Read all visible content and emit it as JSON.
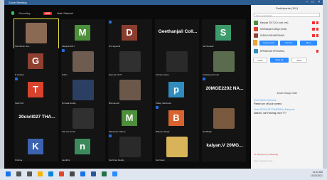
{
  "window": {
    "title": "Zoom Meeting"
  },
  "video": {
    "recording_label": "Recording",
    "live_label": "LIVE",
    "host_label": "Host: Sashank"
  },
  "tiles": [
    {
      "type": "photo",
      "color": "#8a6a52",
      "name": "Sai Mohan Sai...",
      "active": true
    },
    {
      "type": "avatar",
      "letter": "M",
      "color": "#4d8f3a",
      "name": "Manjula 2017"
    },
    {
      "type": "avatar",
      "letter": "D",
      "color": "#8a3d2e",
      "name": "DS Jayanthi"
    },
    {
      "type": "text",
      "big": "Geethanjali Coll...",
      "name": ""
    },
    {
      "type": "avatar",
      "letter": "S",
      "color": "#3c9b6a",
      "name": "Sai Sreekar"
    },
    {
      "type": "avatar",
      "letter": "G",
      "color": "#8f4030",
      "name": "R ismitha"
    },
    {
      "type": "photo",
      "color": "#6f5c50",
      "name": "Nithin"
    },
    {
      "type": "photo",
      "color": "#303030",
      "name": "Samuel Fit IIT"
    },
    {
      "type": "photo",
      "color": "#2a2a2a",
      "name": "Sai Sree Kaur"
    },
    {
      "type": "photo",
      "color": "#5a6b4e",
      "name": "Chaitanya Kumar"
    },
    {
      "type": "avatar",
      "letter": "T",
      "color": "#d9432e",
      "name": "SHAYAN"
    },
    {
      "type": "photo",
      "color": "#2b3f63",
      "name": "Nirmala Reddy"
    },
    {
      "type": "photo",
      "color": "#6b584a",
      "name": "Bhuvanesh"
    },
    {
      "type": "avatar",
      "letter": "p",
      "color": "#2f8cbf",
      "name": "Pallay Vaishnavi"
    },
    {
      "type": "text",
      "big": "20MGE2202 NA...",
      "name": ""
    },
    {
      "type": "text",
      "big": "20civil027 THA...",
      "name": ""
    },
    {
      "type": "photo",
      "color": "#303030",
      "name": "Sai ravi kumar"
    },
    {
      "type": "avatar",
      "letter": "M",
      "color": "#4d8f3a",
      "name": "Mahender Valluru"
    },
    {
      "type": "avatar",
      "letter": "B",
      "color": "#d9632e",
      "name": "Bhavani Singh"
    },
    {
      "type": "photo",
      "color": "#7a5a3e",
      "name": "Sai Balaji"
    },
    {
      "type": "avatar",
      "letter": "K",
      "color": "#3c63b0",
      "name": "Krishna"
    },
    {
      "type": "avatar",
      "letter": "n",
      "color": "#3c8a5c",
      "name": "nandhini"
    },
    {
      "type": "photo",
      "color": "#2a2a2a",
      "name": "Sai Kiran Reddy"
    },
    {
      "type": "photo",
      "color": "#d8b35a",
      "name": "Sai Vivek"
    },
    {
      "type": "text",
      "big": "kalyan.V 20MG...",
      "name": ""
    }
  ],
  "participants": {
    "header": "Participants (151)",
    "search_placeholder": "Find a participant",
    "rows": [
      {
        "name": "Manjula 2017 (Co-host, me)",
        "color": "#4d8f3a"
      },
      {
        "name": "Geethanjali College (Host)",
        "color": "#d9432e"
      },
      {
        "name": "2ADAL18 BHARGAVAN",
        "color": "#8f4030"
      }
    ],
    "btn_lower": "Lower Hand",
    "btn_unmute": "Unmute",
    "btn_more": "More",
    "row4": "APPADGUR PRIYANKA",
    "btn_invite": "Invite",
    "btn_mute_all": "Mute All",
    "btn_more2": "More"
  },
  "chat": {
    "header": "Zoom Group Chat",
    "lines": [
      {
        "from": "From SAI to Everyone:",
        "msg": "Please turn off your camera"
      },
      {
        "from": "From 20CIVIL027 THARUN to Everyone:",
        "msg": "Madam i can't hearing voice ???"
      }
    ],
    "send_to": "To: Everyone  (in Meeting)",
    "input_placeholder": "Type message here..."
  },
  "taskbar": {
    "time": "11:41 AM",
    "date": "11/03/2021",
    "icons": [
      "start-icon",
      "search-icon",
      "task-view-icon",
      "explorer-icon",
      "edge-icon",
      "chrome-icon",
      "store-icon",
      "mail-icon",
      "word-icon",
      "excel-icon",
      "zoom-icon"
    ]
  }
}
